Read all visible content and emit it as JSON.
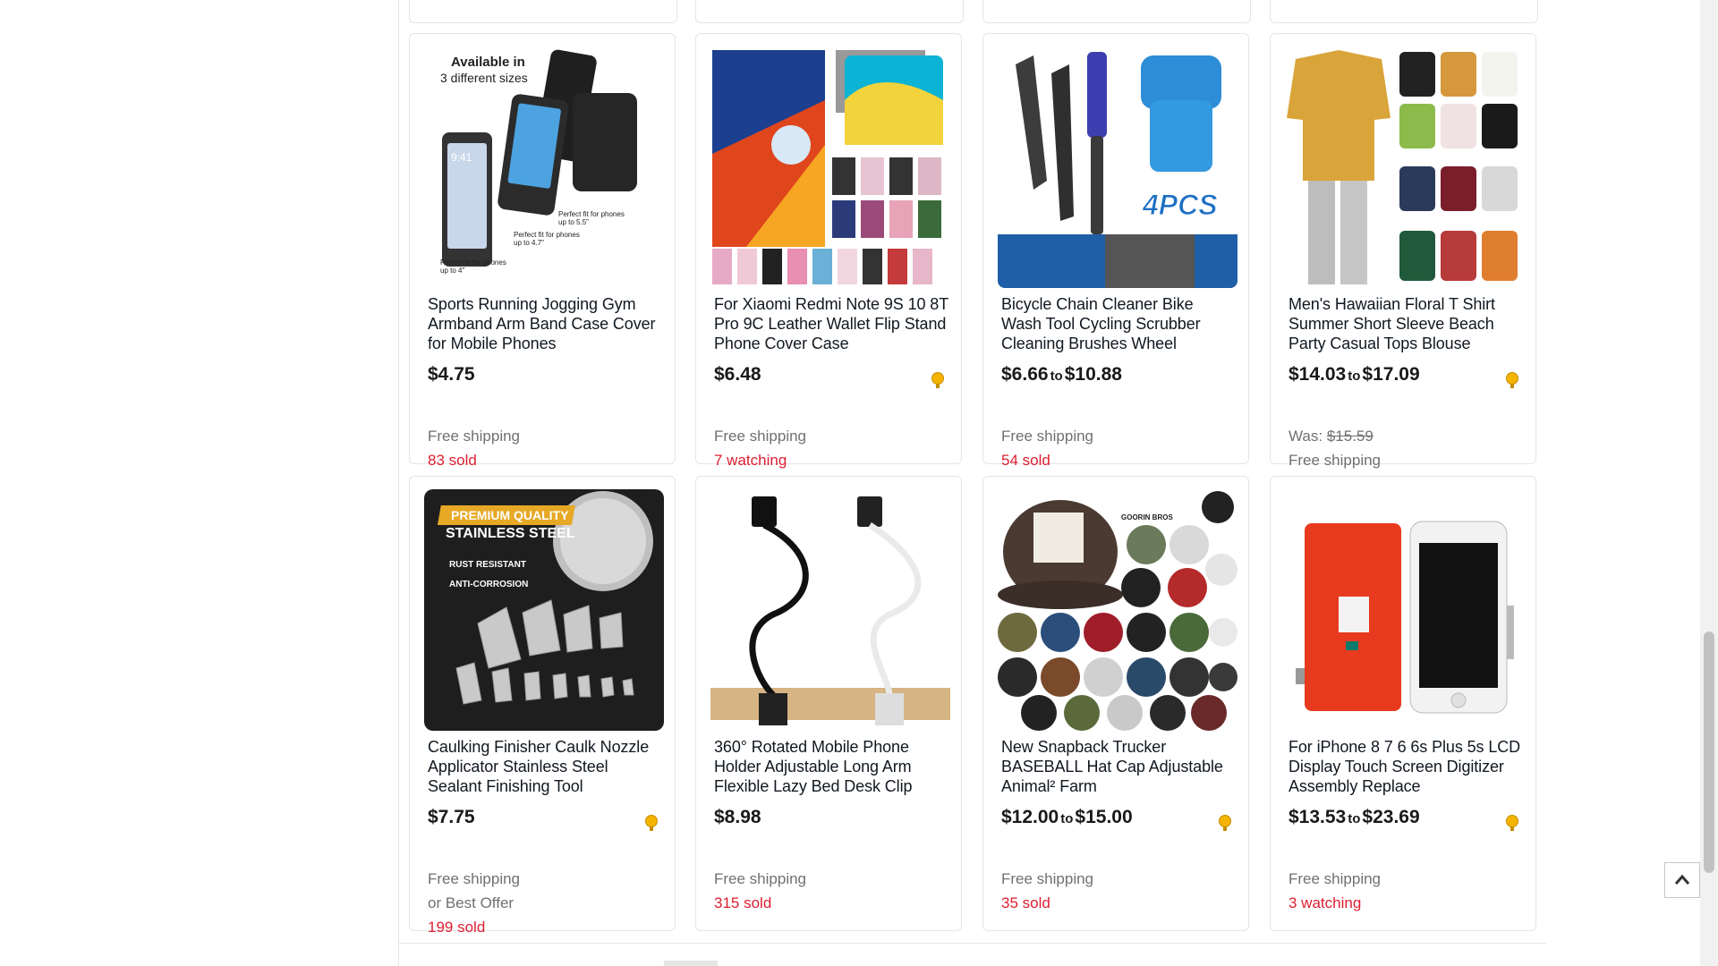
{
  "products": [
    {
      "title": "Sports Running Jogging Gym Armband Arm Band Case Cover for Mobile Phones",
      "price_from": "$4.75",
      "price_to": "",
      "range_word": "",
      "lines": [
        "Free shipping",
        "83 sold"
      ],
      "line_styles": [
        "grey",
        "red"
      ],
      "badge": false,
      "image_icon": "phone-armband-image",
      "image_text": {
        "t1": "Available in",
        "t2": "3 different sizes",
        "a": "Perfect fit for phones",
        "b": "up to 5.5\"",
        "c": "Perfect fit for phones",
        "d": "up to 4.7\"",
        "e": "Perfect fit for phones",
        "f": "up to 4\""
      }
    },
    {
      "title": "For Xiaomi Redmi Note 9S 10 8T Pro 9C Leather Wallet Flip Stand Phone Cover Case",
      "price_from": "$6.48",
      "price_to": "",
      "range_word": "",
      "lines": [
        "Free shipping",
        "7 watching"
      ],
      "line_styles": [
        "grey",
        "red"
      ],
      "badge": true,
      "image_icon": "wallet-phone-case-image"
    },
    {
      "title": "Bicycle Chain Cleaner Bike Wash Tool Cycling Scrubber Cleaning Brushes Wheel",
      "price_from": "$6.66",
      "price_to": "$10.88",
      "range_word": "to",
      "lines": [
        "Free shipping",
        "54 sold"
      ],
      "line_styles": [
        "grey",
        "red"
      ],
      "badge": false,
      "image_icon": "chain-cleaner-image",
      "image_text": {
        "t1": "4PCS"
      }
    },
    {
      "title": "Men's Hawaiian Floral T Shirt Summer Short Sleeve Beach Party Casual Tops Blouse",
      "price_from": "$14.03",
      "price_to": "$17.09",
      "range_word": "to",
      "was_label": "Was:",
      "was_price": "$15.59",
      "lines": [
        "Free shipping"
      ],
      "line_styles": [
        "grey"
      ],
      "badge": true,
      "image_icon": "hawaiian-shirts-image"
    },
    {
      "title": "Caulking Finisher Caulk Nozzle Applicator Stainless Steel Sealant Finishing Tool",
      "price_from": "$7.75",
      "price_to": "",
      "range_word": "",
      "lines": [
        "Free shipping",
        "or Best Offer",
        "199 sold"
      ],
      "line_styles": [
        "grey",
        "grey",
        "red"
      ],
      "badge": true,
      "image_icon": "caulk-nozzles-image",
      "image_text": {
        "t1": "PREMIUM QUALITY",
        "t2": "STAINLESS STEEL",
        "t3": "RUST RESISTANT",
        "t4": "ANTI-CORROSION"
      }
    },
    {
      "title": "360° Rotated Mobile Phone Holder Adjustable Long Arm Flexible Lazy Bed Desk Clip",
      "price_from": "$8.98",
      "price_to": "",
      "range_word": "",
      "lines": [
        "Free shipping",
        "315 sold"
      ],
      "line_styles": [
        "grey",
        "red"
      ],
      "badge": false,
      "image_icon": "gooseneck-phone-holder-image"
    },
    {
      "title": "New Snapback Trucker BASEBALL Hat Cap Adjustable Animal² Farm",
      "price_from": "$12.00",
      "price_to": "$15.00",
      "range_word": "to",
      "lines": [
        "Free shipping",
        "35 sold"
      ],
      "line_styles": [
        "grey",
        "red"
      ],
      "badge": true,
      "image_icon": "trucker-hats-image",
      "image_text": {
        "t1": "GOORIN BROS"
      }
    },
    {
      "title": "For iPhone 8 7 6 6s Plus 5s LCD Display Touch Screen Digitizer Assembly Replace",
      "price_from": "$13.53",
      "price_to": "$23.69",
      "range_word": "to",
      "lines": [
        "Free shipping",
        "3 watching"
      ],
      "line_styles": [
        "grey",
        "red"
      ],
      "badge": true,
      "image_icon": "iphone-lcd-screen-image"
    }
  ],
  "colors": {
    "title": "#111820",
    "price": "#191919",
    "grey_text": "#707070",
    "red_text": "#dd1e31",
    "border": "#e5e5e5"
  },
  "icons": {
    "badge": "top-rated-badge-icon",
    "scroll_up": "chevron-up-icon"
  }
}
